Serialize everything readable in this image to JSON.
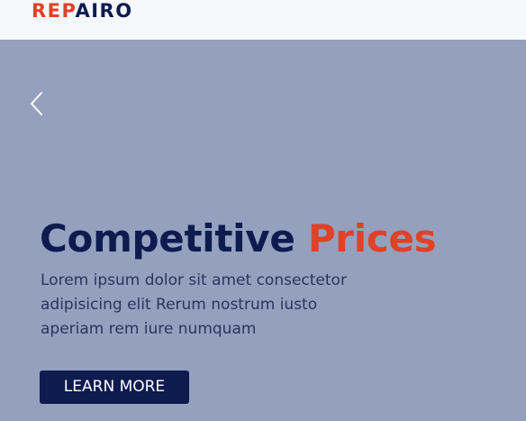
{
  "header": {
    "logo_part1": "REP",
    "logo_part2": "AIRO"
  },
  "hero": {
    "prev_icon": "chevron-left-icon",
    "title_part1": "Competitive ",
    "title_part2": "Prices",
    "description": "Lorem ipsum dolor sit amet consectetor adipisicing elit Rerum nostrum iusto aperiam rem iure numquam",
    "button_label": "LEARN MORE"
  },
  "colors": {
    "brand_navy": "#0d1b4f",
    "brand_red": "#e04226",
    "hero_bg": "#95a0be",
    "header_bg": "#f7f8fb"
  }
}
